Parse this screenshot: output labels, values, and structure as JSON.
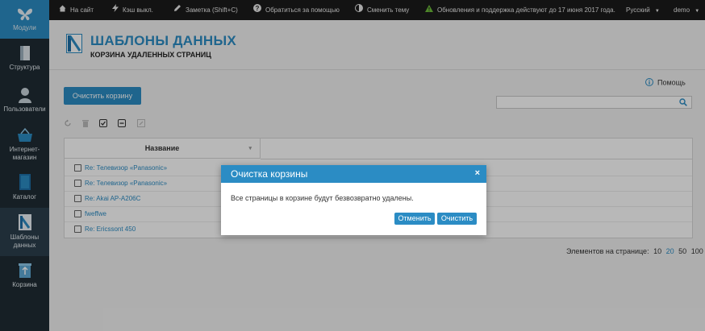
{
  "sidebar": {
    "items": [
      {
        "label": "Модули",
        "icon": "butterfly-icon"
      },
      {
        "label": "Структура",
        "icon": "structure-icon"
      },
      {
        "label": "Пользователи",
        "icon": "user-icon"
      },
      {
        "label": "Интернет-",
        "label2": "магазин",
        "icon": "basket-icon"
      },
      {
        "label": "Каталог",
        "icon": "catalog-icon"
      },
      {
        "label": "Шаблоны",
        "label2": "данных",
        "icon": "data-templates-icon"
      },
      {
        "label": "Корзина",
        "icon": "trash-icon"
      }
    ]
  },
  "topbar": {
    "site": "На сайт",
    "cache": "Кэш выкл.",
    "note": "Заметка (Shift+C)",
    "help": "Обратиться за помощью",
    "theme": "Сменить тему",
    "updates": "Обновления и поддержка действуют до 17 июня 2017 года.",
    "language": "Русский",
    "user": "demo"
  },
  "header": {
    "title": "ШАБЛОНЫ ДАННЫХ",
    "subtitle": "КОРЗИНА УДАЛЕННЫХ СТРАНИЦ"
  },
  "main": {
    "help_label": "Помощь",
    "clear_button": "Очистить корзину",
    "search_placeholder": "",
    "table": {
      "column": "Название",
      "rows": [
        "Re: Телевизор «Panasonic»",
        "Re: Телевизор «Panasonic»",
        "Re: Akai AP-A206C",
        "fweffwe",
        "Re: Ericssont 450"
      ]
    },
    "pagination": {
      "label": "Элементов на странице:",
      "options": [
        "10",
        "20",
        "50",
        "100"
      ],
      "selected": "20"
    }
  },
  "modal": {
    "title": "Очистка корзины",
    "close": "×",
    "message": "Все страницы в корзине будут безвозвратно удалены.",
    "cancel": "Отменить",
    "confirm": "Очистить"
  },
  "colors": {
    "accent": "#2b8cc4",
    "sidebar": "#1f2b34",
    "topbar": "#1b1b1b"
  }
}
